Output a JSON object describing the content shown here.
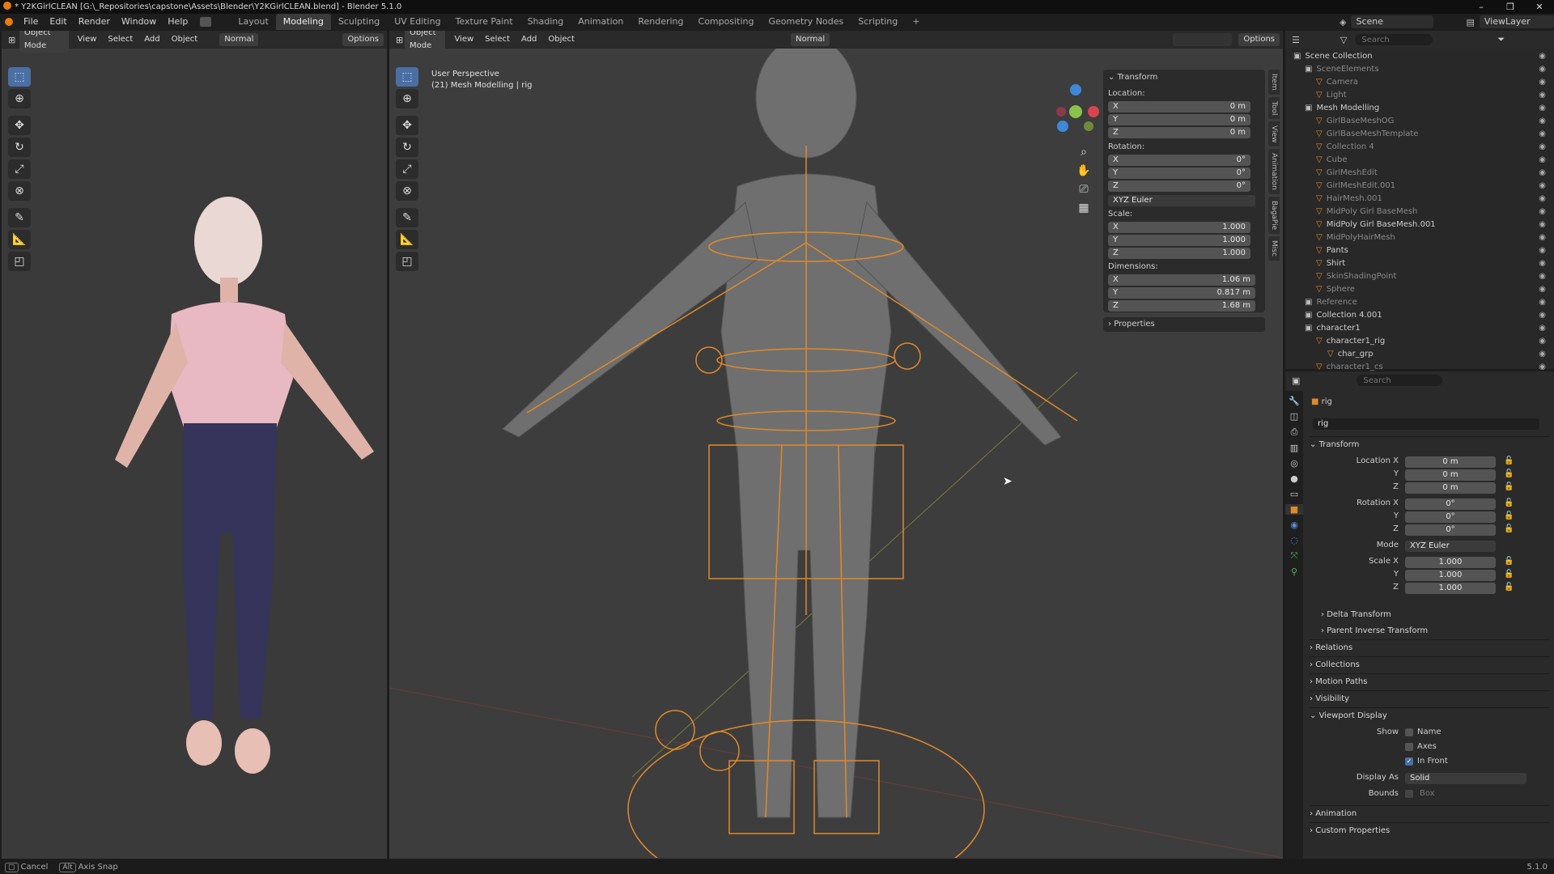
{
  "window": {
    "title": "* Y2KGirlCLEAN [G:\\_Repositories\\capstone\\Assets\\Blender\\Y2KGirlCLEAN.blend] - Blender 5.1.0",
    "min": "–",
    "max": "❐",
    "close": "✕"
  },
  "menu": [
    "File",
    "Edit",
    "Render",
    "Window",
    "Help"
  ],
  "workspaces": [
    "Layout",
    "Modeling",
    "Sculpting",
    "UV Editing",
    "Texture Paint",
    "Shading",
    "Animation",
    "Rendering",
    "Compositing",
    "Geometry Nodes",
    "Scripting"
  ],
  "active_workspace": "Modeling",
  "scene": {
    "name": "Scene",
    "view_layer": "ViewLayer"
  },
  "left_viewport": {
    "mode": "Object Mode",
    "menus": [
      "View",
      "Select",
      "Add",
      "Object"
    ],
    "orientation": "Normal",
    "options": "Options"
  },
  "main_viewport": {
    "mode": "Object Mode",
    "menus": [
      "View",
      "Select",
      "Add",
      "Object"
    ],
    "orientation": "Normal",
    "options": "Options",
    "overlay_title": "User Perspective",
    "overlay_sub": "(21) Mesh Modelling | rig"
  },
  "npanel": {
    "tabs": [
      "Item",
      "Tool",
      "View",
      "Animation",
      "BagaPie",
      "Misc"
    ],
    "transform": "Transform",
    "location_label": "Location:",
    "location": {
      "x": "0 m",
      "y": "0 m",
      "z": "0 m"
    },
    "rotation_label": "Rotation:",
    "rotation": {
      "x": "0°",
      "y": "0°",
      "z": "0°"
    },
    "rotation_mode": "XYZ Euler",
    "scale_label": "Scale:",
    "scale": {
      "x": "1.000",
      "y": "1.000",
      "z": "1.000"
    },
    "dimensions_label": "Dimensions:",
    "dimensions": {
      "x": "1.06 m",
      "y": "0.817 m",
      "z": "1.68 m"
    },
    "properties": "Properties",
    "axes": {
      "x": "X",
      "y": "Y",
      "z": "Z"
    }
  },
  "outliner": {
    "search_placeholder": "Search",
    "rows": [
      {
        "label": "Scene Collection",
        "indent": 0,
        "dim": false
      },
      {
        "label": "SceneElements",
        "indent": 1,
        "dim": true
      },
      {
        "label": "Camera",
        "indent": 2,
        "dim": true
      },
      {
        "label": "Light",
        "indent": 2,
        "dim": true
      },
      {
        "label": "Mesh Modelling",
        "indent": 1,
        "dim": false
      },
      {
        "label": "GirlBaseMeshOG",
        "indent": 2,
        "dim": true
      },
      {
        "label": "GirlBaseMeshTemplate",
        "indent": 2,
        "dim": true
      },
      {
        "label": "Collection 4",
        "indent": 2,
        "dim": true
      },
      {
        "label": "Cube",
        "indent": 2,
        "dim": true
      },
      {
        "label": "GirlMeshEdit",
        "indent": 2,
        "dim": true
      },
      {
        "label": "GirlMeshEdit.001",
        "indent": 2,
        "dim": true
      },
      {
        "label": "HairMesh.001",
        "indent": 2,
        "dim": true
      },
      {
        "label": "MidPoly Girl BaseMesh",
        "indent": 2,
        "dim": true
      },
      {
        "label": "MidPoly Girl BaseMesh.001",
        "indent": 2,
        "dim": false
      },
      {
        "label": "MidPolyHairMesh",
        "indent": 2,
        "dim": true
      },
      {
        "label": "Pants",
        "indent": 2,
        "dim": false
      },
      {
        "label": "Shirt",
        "indent": 2,
        "dim": false
      },
      {
        "label": "SkinShadingPoint",
        "indent": 2,
        "dim": true
      },
      {
        "label": "Sphere",
        "indent": 2,
        "dim": true
      },
      {
        "label": "Reference",
        "indent": 1,
        "dim": true
      },
      {
        "label": "Collection 4.001",
        "indent": 1,
        "dim": false
      },
      {
        "label": "character1",
        "indent": 1,
        "dim": false
      },
      {
        "label": "character1_rig",
        "indent": 2,
        "dim": false
      },
      {
        "label": "char_grp",
        "indent": 3,
        "dim": false
      },
      {
        "label": "character1_cs",
        "indent": 2,
        "dim": true
      }
    ]
  },
  "properties": {
    "search_placeholder": "Search",
    "object_name": "rig",
    "data_name": "rig",
    "transform": "Transform",
    "location_label": "Location X",
    "location": {
      "x": "0 m",
      "y": "0 m",
      "z": "0 m"
    },
    "rotation_label": "Rotation X",
    "rotation": {
      "x": "0°",
      "y": "0°",
      "z": "0°"
    },
    "mode_label": "Mode",
    "mode": "XYZ Euler",
    "scale_label": "Scale X",
    "scale": {
      "x": "1.000",
      "y": "1.000",
      "z": "1.000"
    },
    "axis_y": "Y",
    "axis_z": "Z",
    "delta": "Delta Transform",
    "parent_inverse": "Parent Inverse Transform",
    "relations": "Relations",
    "collections": "Collections",
    "motion_paths": "Motion Paths",
    "visibility": "Visibility",
    "viewport_display": "Viewport Display",
    "show_label": "Show",
    "show_name": "Name",
    "show_axes": "Axes",
    "show_in_front": "In Front",
    "display_as_label": "Display As",
    "display_as": "Solid",
    "bounds_label": "Bounds",
    "bounds": "Box",
    "animation": "Animation",
    "custom_properties": "Custom Properties"
  },
  "status": {
    "cancel": "Cancel",
    "alt": "Alt",
    "axis_snap": "Axis Snap",
    "version": "5.1.0"
  },
  "colors": {
    "accent": "#4a6fa5",
    "rig": "#e0892a",
    "axis_x": "#d9434f",
    "axis_y": "#8bc34a",
    "axis_z": "#3f87d9"
  }
}
